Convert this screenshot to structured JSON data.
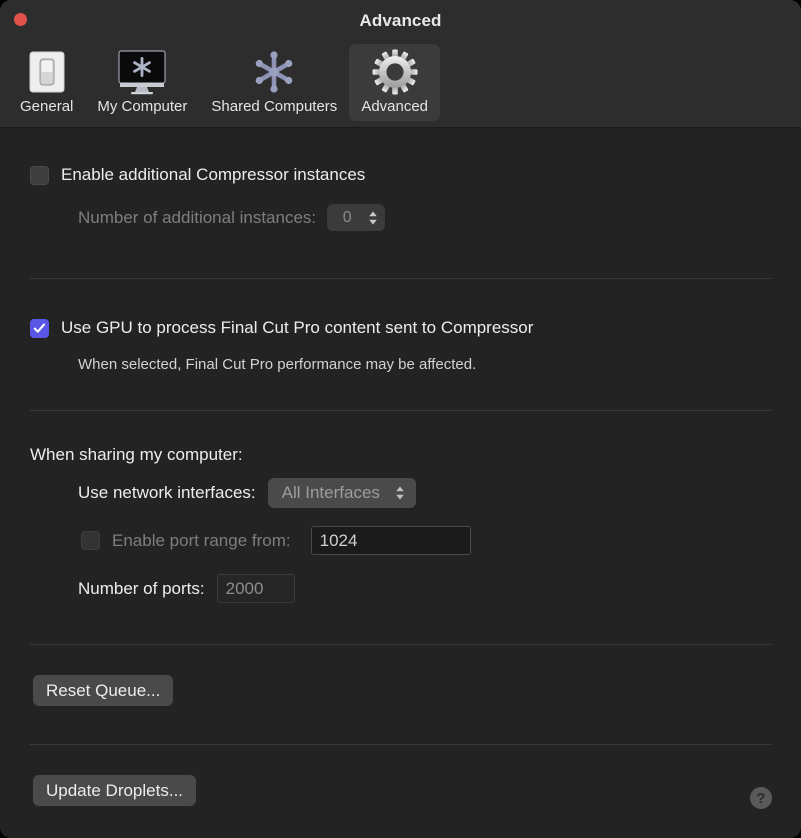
{
  "window": {
    "title": "Advanced",
    "traffic_lights": [
      {
        "name": "close",
        "color": "#e0524a"
      },
      {
        "name": "minimize",
        "color": "#2e2e2e"
      },
      {
        "name": "zoom",
        "color": "#2e2e2e"
      }
    ]
  },
  "toolbar": {
    "tabs": [
      {
        "label": "General",
        "icon": "light-switch-icon",
        "selected": false
      },
      {
        "label": "My Computer",
        "icon": "display-snowflake-icon",
        "selected": false
      },
      {
        "label": "Shared Computers",
        "icon": "cluster-nodes-icon",
        "selected": false
      },
      {
        "label": "Advanced",
        "icon": "gear-icon",
        "selected": true
      }
    ]
  },
  "main": {
    "instances": {
      "checkbox_label": "Enable additional Compressor instances",
      "checkbox_checked": false,
      "count_label": "Number of additional instances:",
      "count_value": "0"
    },
    "gpu": {
      "checkbox_label": "Use GPU to process Final Cut Pro content sent to Compressor",
      "checkbox_checked": true,
      "note": "When selected, Final Cut Pro performance may be affected."
    },
    "sharing": {
      "heading": "When sharing my computer:",
      "interfaces_label": "Use network interfaces:",
      "interfaces_value": "All Interfaces",
      "port_range_label": "Enable port range from:",
      "port_range_checked": false,
      "port_range_value": "1024",
      "num_ports_label": "Number of ports:",
      "num_ports_value": "2000"
    },
    "actions": {
      "reset_queue": "Reset Queue...",
      "update_droplets": "Update Droplets...",
      "help": "?"
    }
  },
  "colors": {
    "checkbox_accent": "#5a57e6",
    "window_bg": "#232323",
    "toolbar_bg": "#2d2d2d",
    "selected_tab_bg": "#3b3b3b"
  }
}
